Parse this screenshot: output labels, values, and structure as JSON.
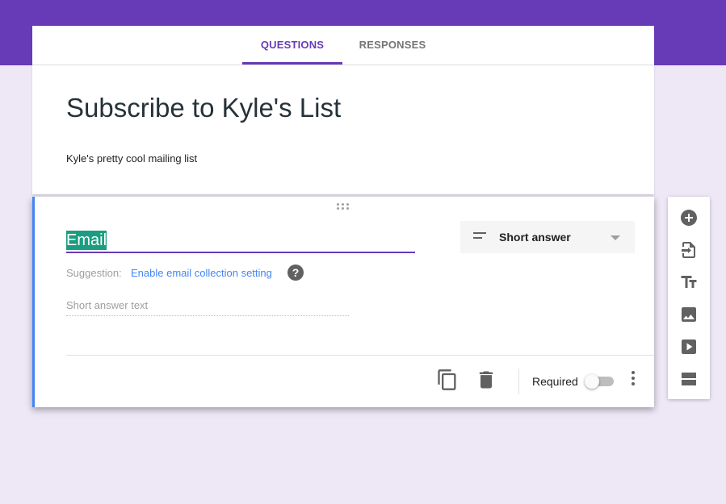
{
  "tabs": [
    {
      "label": "QUESTIONS",
      "active": true
    },
    {
      "label": "RESPONSES",
      "active": false
    }
  ],
  "form": {
    "title": "Subscribe to Kyle's List",
    "description": "Kyle's pretty cool mailing list"
  },
  "question": {
    "title": "Email",
    "suggestion_label": "Suggestion:",
    "suggestion_link": "Enable email collection setting",
    "help_glyph": "?",
    "answer_placeholder": "Short answer text",
    "type_selected": "Short answer",
    "required_label": "Required",
    "required": false
  },
  "footer_actions": [
    {
      "icon": "duplicate-icon"
    },
    {
      "icon": "delete-icon"
    },
    {
      "icon": "more-vert-icon"
    }
  ],
  "side_toolbar": [
    {
      "icon": "add-question-icon"
    },
    {
      "icon": "import-questions-icon"
    },
    {
      "icon": "add-title-icon"
    },
    {
      "icon": "add-image-icon"
    },
    {
      "icon": "add-video-icon"
    },
    {
      "icon": "add-section-icon"
    }
  ],
  "colors": {
    "accent": "#673ab7",
    "question_border": "#4285f4",
    "link": "#4285f4",
    "background": "#ede7f6"
  }
}
